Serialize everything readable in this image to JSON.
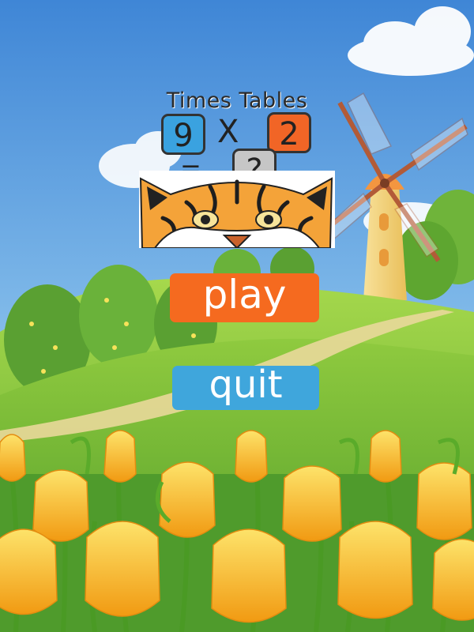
{
  "logo": {
    "title": "Times Tables",
    "first_number": "9",
    "operator": "X",
    "second_number": "2",
    "equals": "=",
    "answer": "?"
  },
  "menu": {
    "play_label": "play",
    "quit_label": "quit"
  },
  "colors": {
    "sky": "#5fa3e0",
    "hill": "#7cc23f",
    "play_button": "#f56a1f",
    "quit_button": "#3fa6dc",
    "tulip": "#f7b51c",
    "windmill_body": "#f6d67a",
    "windmill_roof": "#f39640"
  }
}
